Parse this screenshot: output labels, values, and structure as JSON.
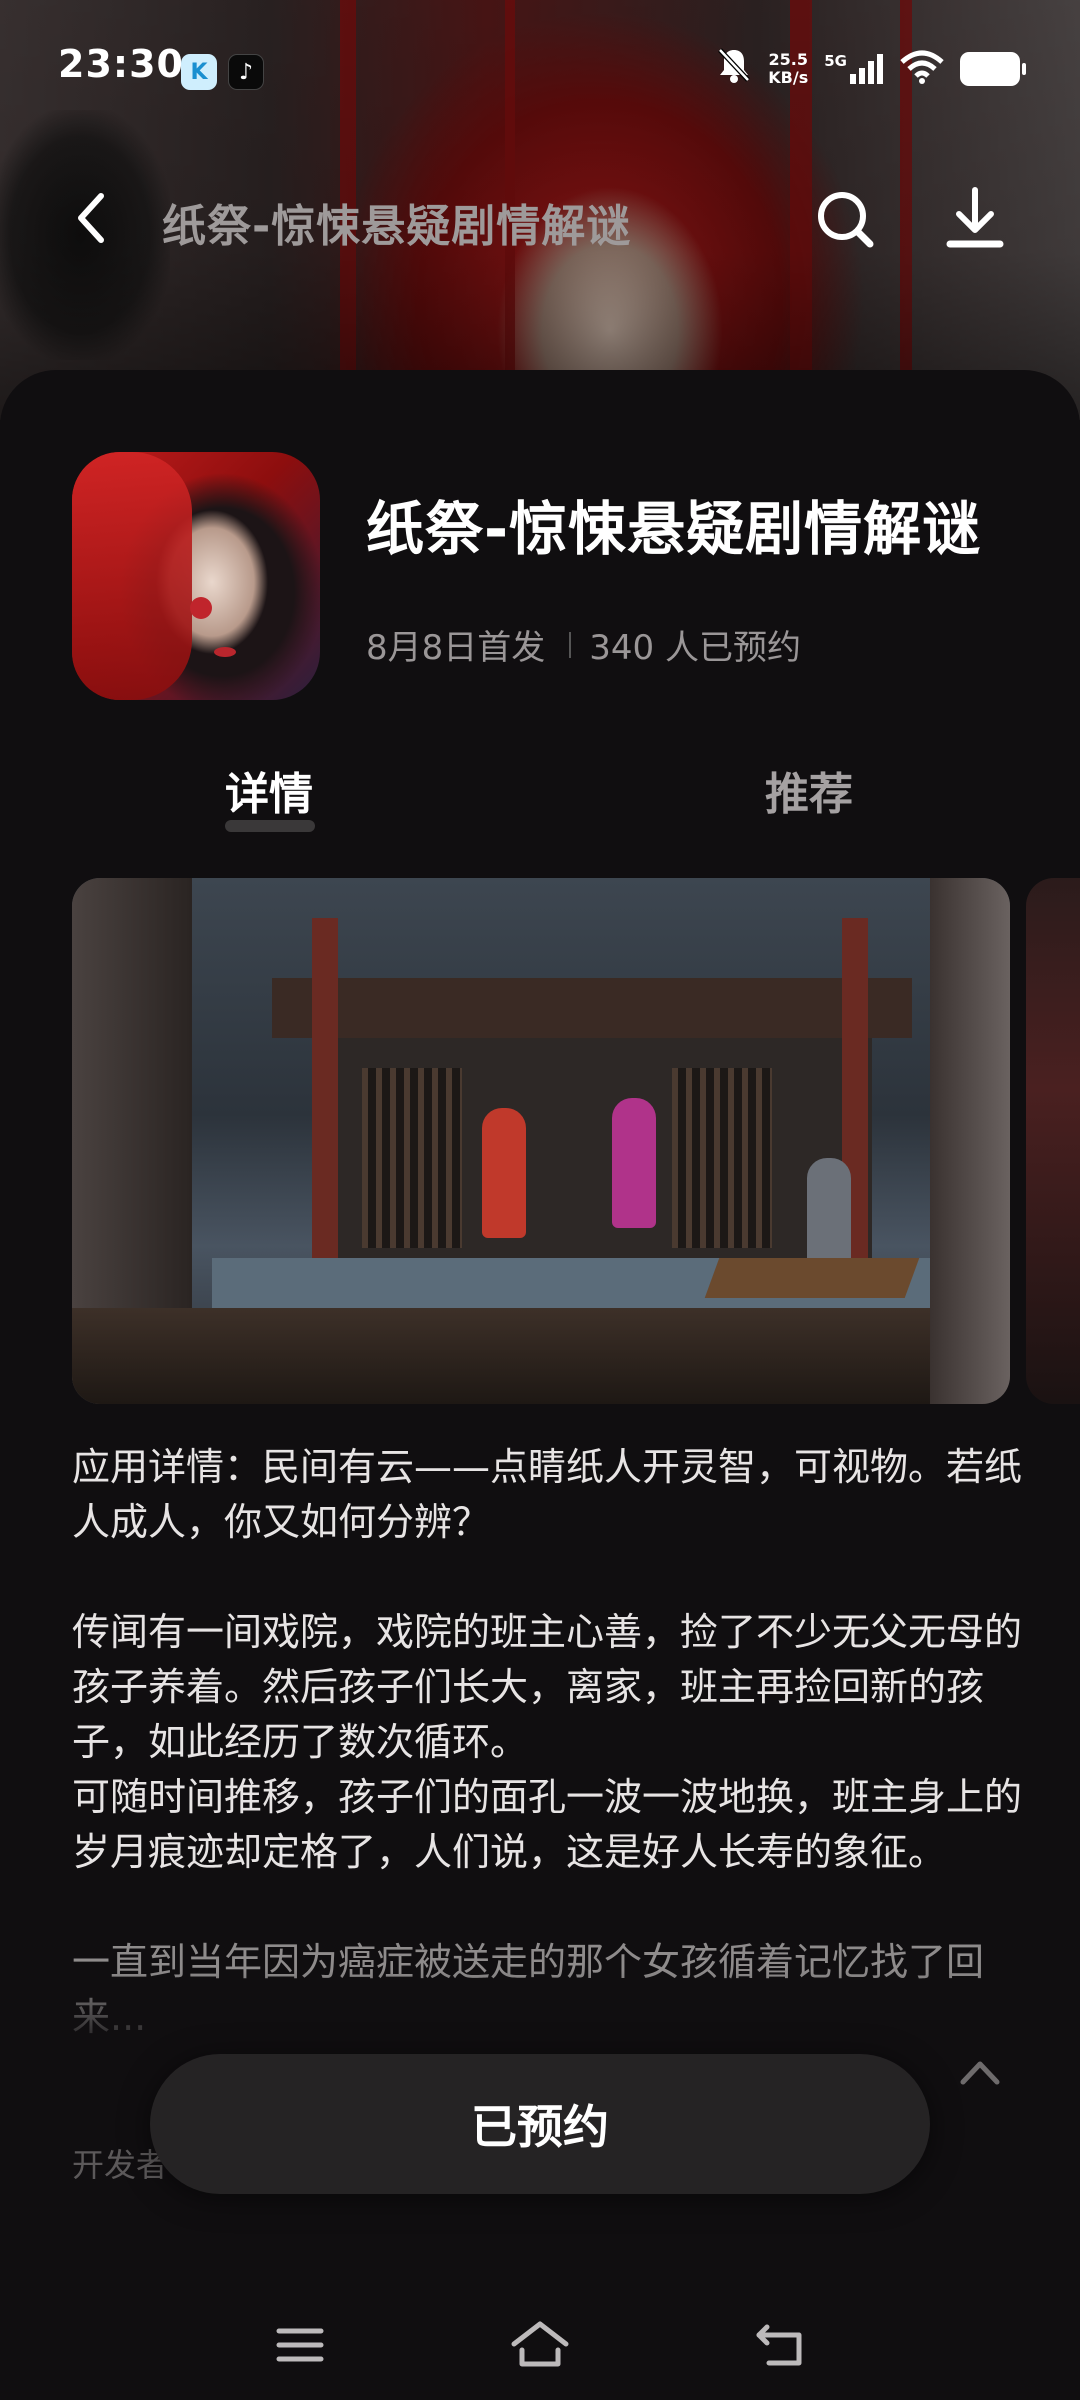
{
  "status_bar": {
    "time": "23:30",
    "app_badges": [
      "K",
      "♪"
    ],
    "net_speed_value": "25.5",
    "net_speed_unit": "KB/s",
    "network": "5G",
    "icons": [
      "bell-off-icon",
      "signal-icon",
      "wifi-icon",
      "battery-icon"
    ]
  },
  "nav": {
    "title": "纸祭-惊悚悬疑剧情解谜",
    "icons": [
      "back-icon",
      "search-icon",
      "download-icon"
    ]
  },
  "app": {
    "name": "纸祭-惊悚悬疑剧情解谜",
    "release": "8月8日首发",
    "reservations": "340 人已预约"
  },
  "tabs": [
    {
      "label": "详情",
      "active": true
    },
    {
      "label": "推荐",
      "active": false
    }
  ],
  "description": {
    "p1": "应用详情：民间有云——点睛纸人开灵智，可视物。若纸人成人，你又如何分辨？",
    "p2": "传闻有一间戏院，戏院的班主心善，捡了不少无父无母的孩子养着。然后孩子们长大，离家，班主再捡回新的孩子，如此经历了数次循环。",
    "p3": "可随时间推移，孩子们的面孔一波一波地换，班主身上的岁月痕迹却定格了，人们说，这是好人长寿的象征。",
    "p4": "一直到当年因为癌症被送走的那个女孩循着记忆找了回来...",
    "developer_label": "开发者"
  },
  "actions": {
    "reserve_label": "已预约"
  },
  "system_nav": {
    "icons": [
      "menu-icon",
      "home-icon",
      "back-nav-icon"
    ]
  },
  "colors": {
    "background": "#100e10",
    "button": "#252324",
    "text_primary": "#ffffff",
    "text_secondary": "#9a9697"
  }
}
